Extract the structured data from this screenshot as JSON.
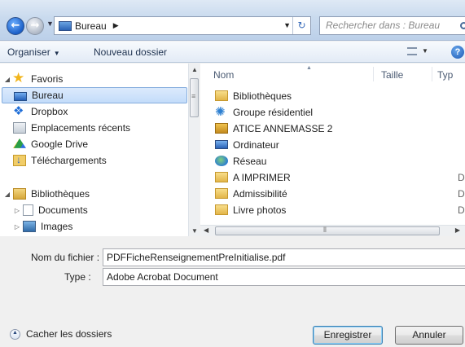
{
  "address": {
    "location": "Bureau"
  },
  "search": {
    "placeholder": "Rechercher dans : Bureau"
  },
  "toolbar": {
    "organize": "Organiser",
    "new_folder": "Nouveau dossier"
  },
  "nav": {
    "items": [
      {
        "label": "Favoris",
        "icon": "star-icon"
      },
      {
        "label": "Bureau",
        "icon": "desktop-icon",
        "selected": true
      },
      {
        "label": "Dropbox",
        "icon": "dropbox-icon"
      },
      {
        "label": "Emplacements récents",
        "icon": "recent-places-icon"
      },
      {
        "label": "Google Drive",
        "icon": "google-drive-icon"
      },
      {
        "label": "Téléchargements",
        "icon": "downloads-icon"
      },
      {
        "label": "Bibliothèques",
        "icon": "libraries-icon"
      },
      {
        "label": "Documents",
        "icon": "documents-icon"
      },
      {
        "label": "Images",
        "icon": "images-icon"
      }
    ]
  },
  "files": {
    "columns": {
      "name": "Nom",
      "size": "Taille",
      "type": "Typ"
    },
    "rows": [
      {
        "name": "Bibliothèques",
        "type": ""
      },
      {
        "name": "Groupe résidentiel",
        "type": ""
      },
      {
        "name": "ATICE ANNEMASSE 2",
        "type": ""
      },
      {
        "name": "Ordinateur",
        "type": ""
      },
      {
        "name": "Réseau",
        "type": ""
      },
      {
        "name": "A IMPRIMER",
        "type": "Dos"
      },
      {
        "name": "Admissibilité",
        "type": "Dos"
      },
      {
        "name": "Livre photos",
        "type": "Dos"
      }
    ]
  },
  "form": {
    "filename_label": "Nom du fichier :",
    "filename_value": "PDFFicheRenseignementPreInitialise.pdf",
    "type_label": "Type :",
    "type_value": "Adobe Acrobat Document"
  },
  "footer": {
    "hide_folders": "Cacher les dossiers",
    "save": "Enregistrer",
    "cancel": "Annuler"
  }
}
